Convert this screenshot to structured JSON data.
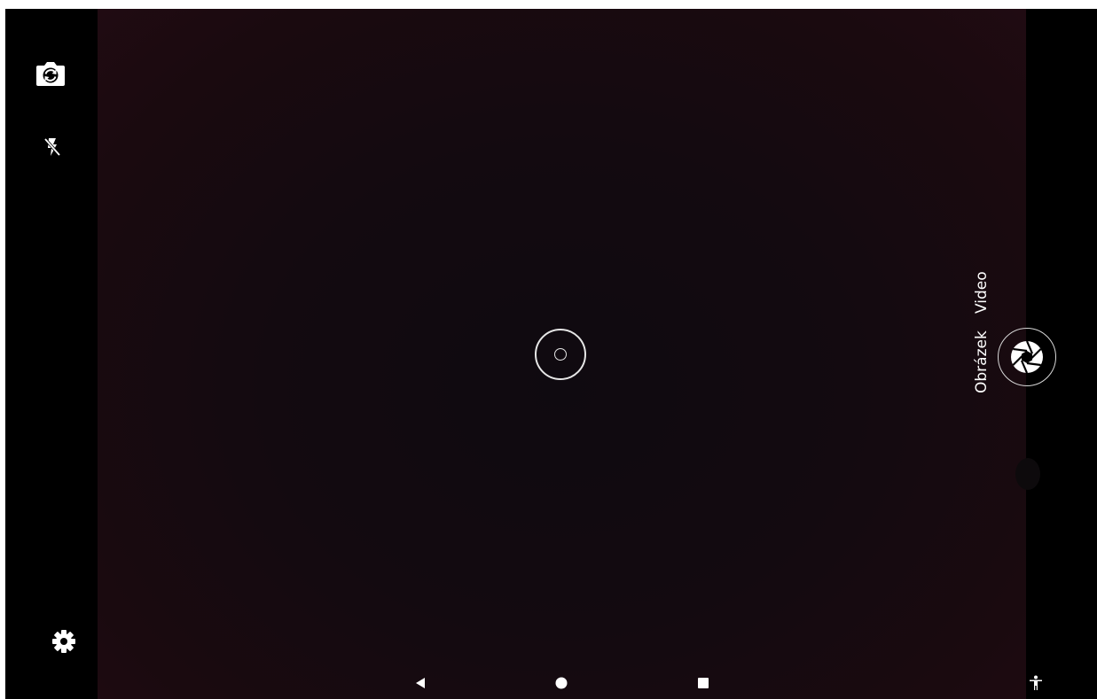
{
  "toolbar": {
    "switch_camera_icon": "switch-camera-icon",
    "flash_icon": "flash-off-icon",
    "settings_icon": "gear-icon"
  },
  "viewfinder": {
    "focus_indicator": "focus-ring-icon"
  },
  "mode_switch": {
    "modes": [
      {
        "label": "Obrázek",
        "selected": true
      },
      {
        "label": "Video",
        "selected": false
      }
    ]
  },
  "shutter": {
    "icon": "aperture-icon"
  },
  "nav_bar": {
    "back_icon": "back-triangle-icon",
    "home_icon": "home-circle-icon",
    "recents_icon": "recents-square-icon",
    "accessibility_icon": "accessibility-icon"
  },
  "colors": {
    "background": "#000000",
    "icon": "#ffffff",
    "viewfinder_tint": "#1a0a0f"
  }
}
